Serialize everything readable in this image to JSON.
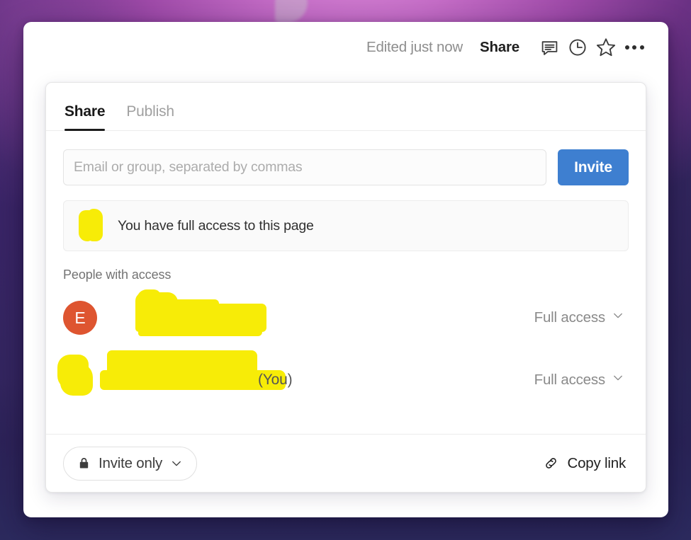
{
  "window": {
    "topbar": {
      "edited_status": "Edited just now",
      "share_label": "Share",
      "icons": [
        {
          "name": "comment-icon",
          "title": "Comments"
        },
        {
          "name": "history-clock-icon",
          "title": "Page history"
        },
        {
          "name": "star-icon",
          "title": "Add to favorites"
        },
        {
          "name": "more-options-icon",
          "title": "More options"
        }
      ]
    }
  },
  "share_panel": {
    "tabs": [
      {
        "label": "Share",
        "active": true
      },
      {
        "label": "Publish",
        "active": false
      }
    ],
    "invite": {
      "placeholder": "Email or group, separated by commas",
      "value": "",
      "button_label": "Invite"
    },
    "banner": {
      "text": "You have full access to this page",
      "avatar_redacted": true
    },
    "people_section": {
      "header": "People with access",
      "rows": [
        {
          "avatar_initial": "E",
          "avatar_color": "#de5530",
          "avatar_redacted": false,
          "name_redacted": true,
          "name_suffix": "",
          "access": "Full access",
          "access_chevron": "chevron-down-icon"
        },
        {
          "avatar_initial": "",
          "avatar_color": "#6b5a7a",
          "avatar_redacted": true,
          "name_redacted": true,
          "name_suffix": "(You)",
          "access": "Full access",
          "access_chevron": "chevron-down-icon"
        }
      ]
    },
    "footer": {
      "visibility_label": "Invite only",
      "visibility_icon": "lock-icon",
      "visibility_chevron": "chevron-down-icon",
      "copy_link_label": "Copy link",
      "copy_link_icon": "link-icon"
    }
  },
  "colors": {
    "accent_blue": "#3e7fd0",
    "avatar_orange": "#de5530",
    "redaction_yellow": "#f7ec07",
    "tab_active_underline": "#1c1c1c"
  }
}
